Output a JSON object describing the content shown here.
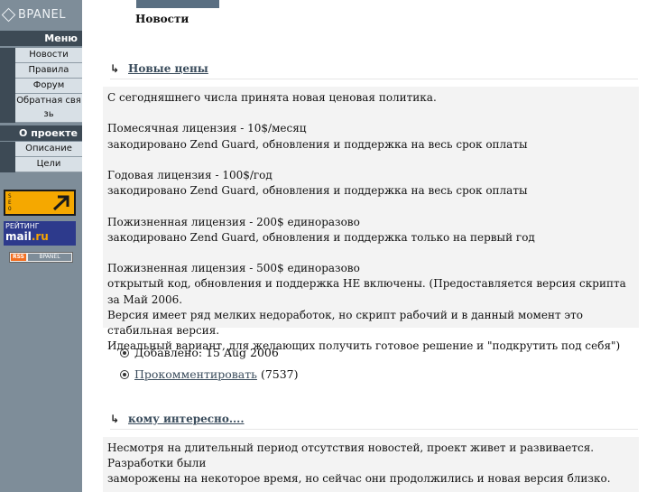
{
  "sidebar": {
    "logo_text": "BPANEL",
    "menu_header": "Меню",
    "menu_items": [
      {
        "label": "Новости"
      },
      {
        "label": "Правила"
      },
      {
        "label": "Форум"
      },
      {
        "label": "Обратная связь"
      }
    ],
    "about_header": "О проекте",
    "about_items": [
      {
        "label": "Описание"
      },
      {
        "label": "Цели"
      }
    ],
    "badges": {
      "seo_text": "SEO",
      "mail_line1": "РЕЙТИНГ",
      "mail_brand": "mail",
      "mail_suffix": ".ru",
      "rss_label": "RSS",
      "bpanel_label": "BPANEL"
    }
  },
  "main": {
    "page_title": "Новости",
    "news": [
      {
        "title": "Новые цены",
        "body": "С сегодняшнего числа принята новая ценовая политика.\n\nПомесячная лицензия - 10$/месяц\nзакодировано Zend Guard, обновления и поддержка на весь срок оплаты\n\nГодовая лицензия - 100$/год\nзакодировано Zend Guard, обновления и поддержка на весь срок оплаты\n\nПожизненная лицензия - 200$ единоразово\nзакодировано Zend Guard, обновления и поддержка только на первый год\n\nПожизненная лицензия - 500$ единоразово\nоткрытый код, обновления и поддержка НЕ включены. (Предоставляется версия скрипта за Май 2006.\nВерсия имеет ряд мелких недоработок, но скрипт рабочий и в данный момент это стабильная версия.\nИдеальный вариант, для желающих получить готовое решение и \"подкрутить под себя\")",
        "added_label": "Добавлено: 15 Aug 2006",
        "comment_link": "Прокомментировать",
        "comment_count": "(7537)"
      },
      {
        "title": "кому интересно....",
        "body": "Несмотря на длительный период отсутствия новостей, проект живет и развивается. Разработки были\nзаморожены на некоторое время, но сейчас они продолжились и новая версия близко."
      }
    ]
  }
}
